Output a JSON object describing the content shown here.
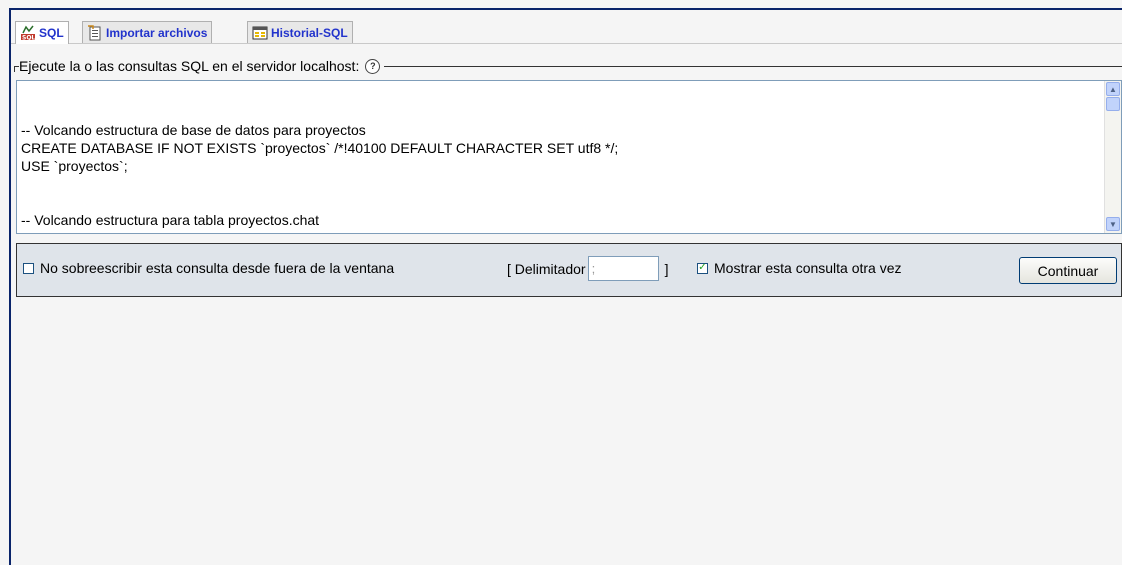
{
  "tabs": [
    {
      "label": "SQL",
      "icon": "sql-icon"
    },
    {
      "label": "Importar archivos",
      "icon": "import-icon"
    },
    {
      "label": "Historial-SQL",
      "icon": "history-icon"
    }
  ],
  "fieldset": {
    "legend": "Ejecute la o las consultas SQL en el servidor localhost:",
    "help_symbol": "?"
  },
  "sql_query": "\n-- Volcando estructura de base de datos para proyectos\nCREATE DATABASE IF NOT EXISTS `proyectos` /*!40100 DEFAULT CHARACTER SET utf8 */;\nUSE `proyectos`;\n\n\n-- Volcando estructura para tabla proyectos.chat",
  "options": {
    "no_overwrite_label": "No sobreescribir esta consulta desde fuera de la ventana",
    "no_overwrite_checked": false,
    "delimiter_open": "[ Delimitador",
    "delimiter_value": ";",
    "delimiter_close": "]",
    "show_again_label": "Mostrar esta consulta otra vez",
    "show_again_checked": true,
    "submit_label": "Continuar"
  },
  "colors": {
    "tab_text": "#2233cc",
    "options_bg": "#dfe4ea",
    "frame_border": "#0a246a"
  }
}
